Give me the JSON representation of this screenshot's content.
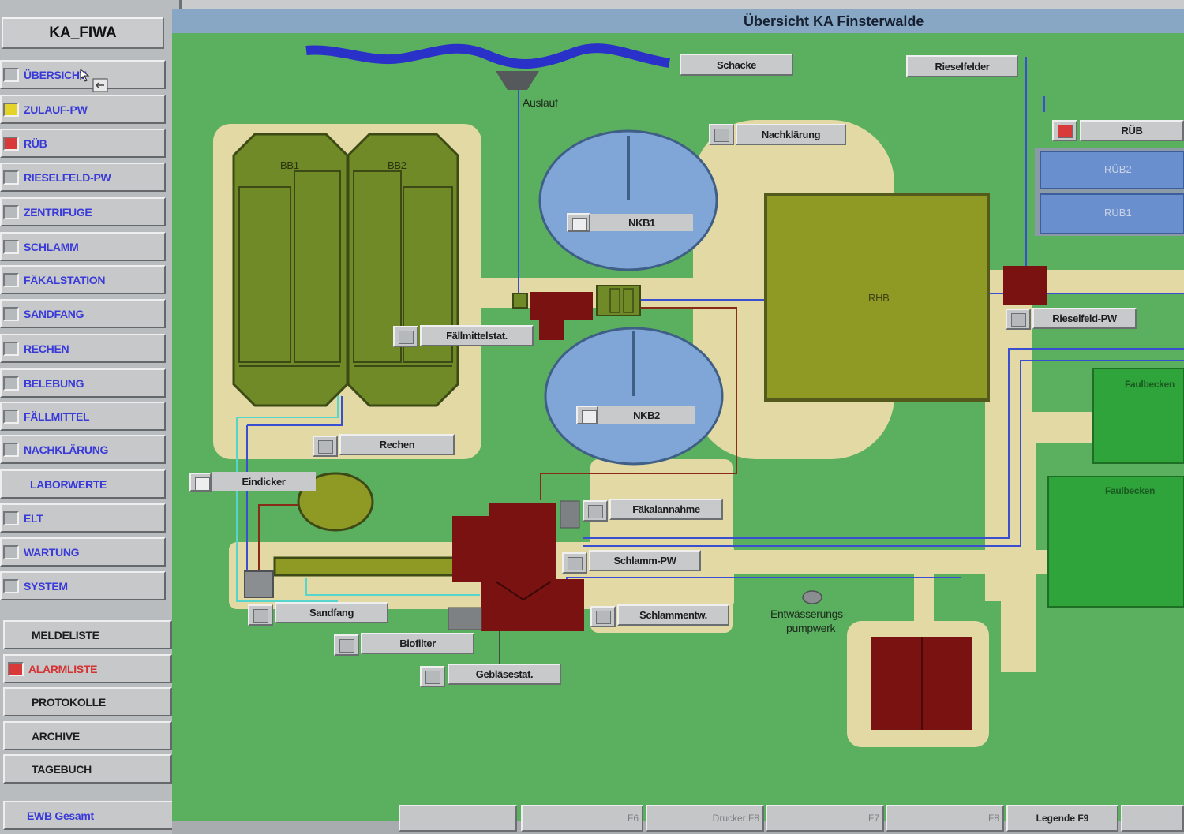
{
  "app": {
    "title": "KA_FIWA"
  },
  "header": {
    "title": "Übersicht KA Finsterwalde"
  },
  "nav": {
    "items": [
      {
        "label": "ÜBERSICHT",
        "lamp": "#b7babc"
      },
      {
        "label": "ZULAUF-PW",
        "lamp": "#e4d42a"
      },
      {
        "label": "RÜB",
        "lamp": "#d83a3a"
      },
      {
        "label": "RIESELFELD-PW",
        "lamp": "#b7babc"
      },
      {
        "label": "ZENTRIFUGE",
        "lamp": "#b7babc"
      },
      {
        "label": "SCHLAMM",
        "lamp": "#b7babc"
      },
      {
        "label": "FÄKALSTATION",
        "lamp": "#b7babc"
      },
      {
        "label": "SANDFANG",
        "lamp": "#b7babc"
      },
      {
        "label": "RECHEN",
        "lamp": "#b7babc"
      },
      {
        "label": "BELEBUNG",
        "lamp": "#b7babc"
      },
      {
        "label": "FÄLLMITTEL",
        "lamp": "#b7babc"
      },
      {
        "label": "NACHKLÄRUNG",
        "lamp": "#b7babc"
      },
      {
        "label": "LABORWERTE",
        "lamp": ""
      },
      {
        "label": "ELT",
        "lamp": "#b7babc"
      },
      {
        "label": "WARTUNG",
        "lamp": "#b7babc"
      },
      {
        "label": "SYSTEM",
        "lamp": "#b7babc"
      }
    ],
    "lists": [
      {
        "label": "MELDELISTE",
        "lamp": ""
      },
      {
        "label": "ALARMLISTE",
        "lamp": "#d83a3a"
      },
      {
        "label": "PROTOKOLLE",
        "lamp": ""
      },
      {
        "label": "ARCHIVE",
        "lamp": ""
      },
      {
        "label": "TAGEBUCH",
        "lamp": ""
      }
    ],
    "footer": "EWB Gesamt"
  },
  "plant": {
    "schacke": "Schacke",
    "rieselfelder": "Rieselfelder",
    "auslauf": "Auslauf",
    "bb1": "BB1",
    "bb2": "BB2",
    "nkb1": "NKB1",
    "nkb2": "NKB2",
    "nachklaerung": "Nachklärung",
    "faellmittelstat": "Fällmittelstat.",
    "rechen": "Rechen",
    "eindicker": "Eindicker",
    "faekalannahme": "Fäkalannahme",
    "schlamm_pw": "Schlamm-PW",
    "schlammentw": "Schlammentw.",
    "sandfang": "Sandfang",
    "biofilter": "Biofilter",
    "geblaesestat": "Gebläsestat.",
    "rhb": "RHB",
    "rueb": "RÜB",
    "rueb2": "RÜB2",
    "rueb1": "RÜB1",
    "rieselfeld_pw": "Rieselfeld-PW",
    "faulbecken_1": "Faulbecken",
    "faulbecken_2": "Faulbecken",
    "entwaesserung_line1": "Entwässerungs-",
    "entwaesserung_line2": "pumpwerk"
  },
  "fkeys": {
    "f6": "F6",
    "drucker": "Drucker F8",
    "f7": "F7",
    "f8": "F8",
    "legende": "Legende F9"
  },
  "colors": {
    "grass": "#5bb05f",
    "sand": "#e3d9a4",
    "basin_olive": "#6f8a26",
    "tank_blue": "#7fa6d6",
    "building_red": "#7a1212",
    "river": "#2a31c9",
    "pipe_blue": "#3a4ed1",
    "pipe_brown": "#8a2b1a",
    "pipe_cyan": "#56d5cf"
  }
}
